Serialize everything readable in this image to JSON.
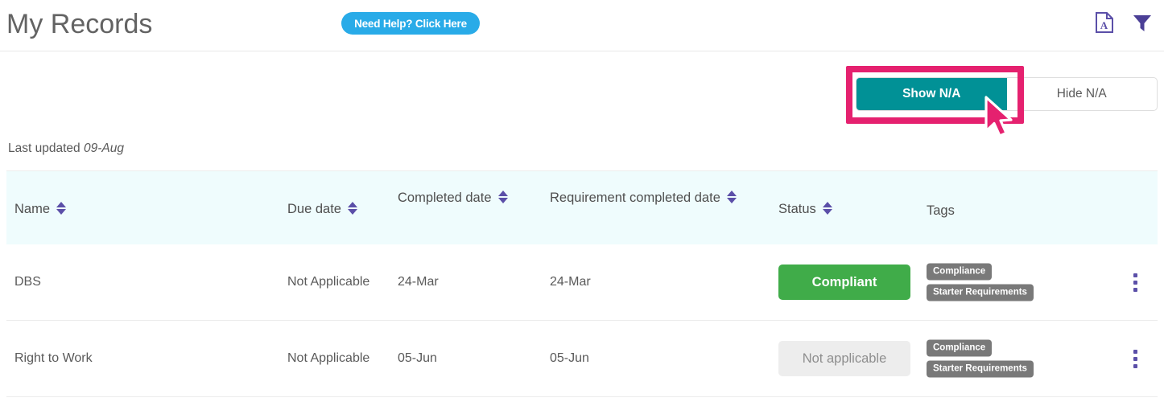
{
  "header": {
    "title": "My Records",
    "help_button": "Need Help? Click Here",
    "pdf_icon": "pdf-export-icon",
    "filter_icon": "filter-funnel-icon"
  },
  "toggle": {
    "show_na": "Show N/A",
    "hide_na": "Hide N/A",
    "active": "Show N/A"
  },
  "meta": {
    "last_updated_label": "Last updated",
    "last_updated_value": "09-Aug"
  },
  "table": {
    "columns": [
      {
        "label": "Name",
        "sortable": true
      },
      {
        "label": "Due date",
        "sortable": true
      },
      {
        "label": "Completed date",
        "sortable": true
      },
      {
        "label": "Requirement completed date",
        "sortable": true
      },
      {
        "label": "Status",
        "sortable": true
      },
      {
        "label": "Tags",
        "sortable": false
      }
    ],
    "rows": [
      {
        "name": "DBS",
        "due_date": "Not Applicable",
        "completed_date": "24-Mar",
        "requirement_completed_date": "24-Mar",
        "status": "Compliant",
        "status_type": "compliant",
        "tags": [
          "Compliance",
          "Starter Requirements"
        ]
      },
      {
        "name": "Right to Work",
        "due_date": "Not Applicable",
        "completed_date": "05-Jun",
        "requirement_completed_date": "05-Jun",
        "status": "Not applicable",
        "status_type": "na",
        "tags": [
          "Compliance",
          "Starter Requirements"
        ]
      }
    ]
  },
  "colors": {
    "accent_teal": "#019196",
    "accent_blue": "#29abe8",
    "annotation_pink": "#e5216f",
    "status_green": "#40ac49",
    "status_grey_bg": "#ededed",
    "tag_grey": "#797979",
    "icon_purple": "#5b4fa8",
    "header_bg": "#effcfd"
  }
}
